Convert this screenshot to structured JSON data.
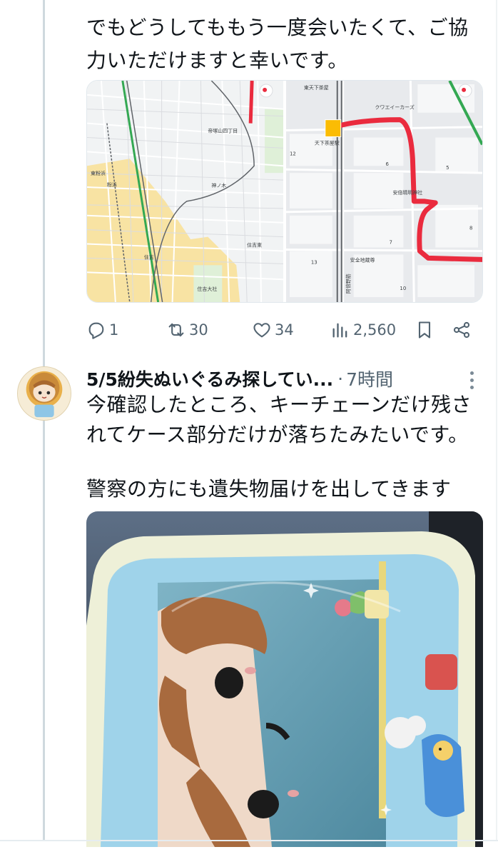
{
  "tweet1": {
    "line1": "でもどうしてももう一度会いたくて、ご協",
    "line2": "力いただけますと幸いです。",
    "map1_labels": {
      "station_a": "帝塚山四丁目",
      "station_b": "東粉浜",
      "area_a": "粉浜",
      "station_c": "神ノ木",
      "station_d": "住吉",
      "station_e": "住吉東",
      "shrine": "住吉大社"
    },
    "map2_labels": {
      "shop": "東天下茶屋",
      "cafe": "クワエイーカーズ",
      "station": "天下茶屋駅",
      "temple": "安倍晴明神社",
      "restaurant": "安全地蔵尊",
      "street": "阿倍野筋",
      "num_12": "12",
      "num_6": "6",
      "num_5": "5",
      "num_8": "8",
      "num_7": "7",
      "num_13": "13",
      "num_10": "10"
    },
    "actions": {
      "replies": "1",
      "reposts": "30",
      "likes": "34",
      "views": "2,560"
    }
  },
  "tweet2": {
    "display_name": "5/5紛失ぬいぐるみ探してい...",
    "separator": "·",
    "time": "7時間",
    "line1": "今確認したところ、キーチェーンだけ残さ",
    "line2": "れてケース部分だけが落ちたみたいです。",
    "line3": "警察の方にも遺失物届けを出してきます"
  },
  "colors": {
    "thread_line": "#cfd9de",
    "icon_gray": "#536471",
    "route_red": "#ea2b3e",
    "rail_green": "#34a853",
    "residential_yellow": "#f8e3a3"
  },
  "icons": {
    "reply": "reply-icon",
    "repost": "repost-icon",
    "like": "heart-icon",
    "views": "views-chart-icon",
    "bookmark": "bookmark-icon",
    "share": "share-icon",
    "more": "more-icon"
  }
}
